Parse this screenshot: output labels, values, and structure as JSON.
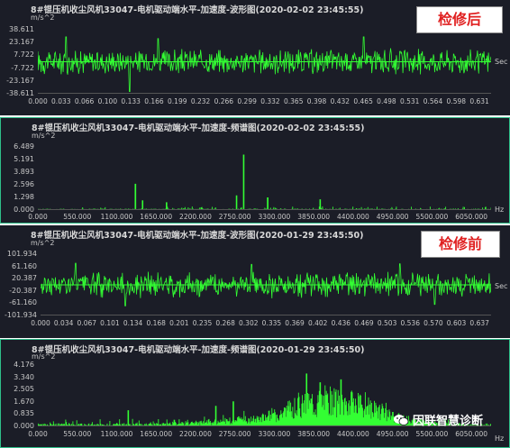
{
  "panels": [
    {
      "title": "8#锟压机收尘风机33047-电机驱动端水平-加速度-波形图(2020-02-02 23:45:55)",
      "unit": "m/s^2",
      "xunit": "Sec",
      "badge": "检修后",
      "yticks": [
        "38.611",
        "23.167",
        "7.722",
        "-7.722",
        "-23.167",
        "-38.611"
      ],
      "xticks": [
        "0.000",
        "0.033",
        "0.066",
        "0.100",
        "0.133",
        "0.166",
        "0.199",
        "0.232",
        "0.266",
        "0.299",
        "0.332",
        "0.365",
        "0.398",
        "0.432",
        "0.465",
        "0.498",
        "0.531",
        "0.564",
        "0.598",
        "0.631"
      ]
    },
    {
      "title": "8#锟压机收尘风机33047-电机驱动端水平-加速度-频谱图(2020-02-02 23:45:55)",
      "unit": "m/s^2",
      "xunit": "Hz",
      "yticks": [
        "6.489",
        "5.191",
        "3.893",
        "2.596",
        "1.298",
        "0.000"
      ],
      "xticks": [
        "0.000",
        "550.000",
        "1100.000",
        "1650.000",
        "2200.000",
        "2750.000",
        "3300.000",
        "3850.000",
        "4400.000",
        "4950.000",
        "5500.000",
        "6050.000"
      ]
    },
    {
      "title": "8#锟压机收尘风机33047-电机驱动端水平-加速度-波形图(2020-01-29 23:45:50)",
      "unit": "m/s^2",
      "xunit": "Sec",
      "badge": "检修前",
      "yticks": [
        "101.934",
        "61.160",
        "20.387",
        "-20.387",
        "-61.160",
        "-101.934"
      ],
      "xticks": [
        "0.000",
        "0.034",
        "0.067",
        "0.101",
        "0.134",
        "0.168",
        "0.201",
        "0.235",
        "0.268",
        "0.302",
        "0.335",
        "0.369",
        "0.402",
        "0.436",
        "0.469",
        "0.503",
        "0.536",
        "0.570",
        "0.603",
        "0.637"
      ]
    },
    {
      "title": "8#锟压机收尘风机33047-电机驱动端水平-加速度-频谱图(2020-01-29 23:45:50)",
      "unit": "m/s^2",
      "xunit": "Hz",
      "yticks": [
        "4.176",
        "3.340",
        "2.505",
        "1.670",
        "0.835",
        "0.000"
      ],
      "xticks": [
        "0.000",
        "550.000",
        "1100.000",
        "1650.000",
        "2200.000",
        "2750.000",
        "3300.000",
        "3850.000",
        "4400.000",
        "4950.000",
        "5500.000",
        "6050.000"
      ]
    }
  ],
  "logo": {
    "text": "因联智慧诊断",
    "icon": "wechat-icon"
  },
  "colors": {
    "signal": "#33ff33",
    "background": "#1b1d27",
    "badge_text": "#e02020"
  },
  "chart_data": [
    {
      "type": "line",
      "title": "8#锟压机收尘风机33047-电机驱动端水平-加速度-波形图(2020-02-02 23:45:55)",
      "xlabel": "Sec",
      "ylabel": "m/s^2",
      "xlim": [
        0,
        0.64
      ],
      "ylim": [
        -38.611,
        38.611
      ],
      "series": [
        {
          "kind": "noise",
          "amplitude": 14,
          "spikes": [
            [
              0.04,
              30
            ],
            [
              0.13,
              -36
            ],
            [
              0.17,
              28
            ],
            [
              0.46,
              30
            ]
          ],
          "samples": 700
        }
      ]
    },
    {
      "type": "line",
      "title": "8#锟压机收尘风机33047-电机驱动端水平-加速度-频谱图(2020-02-02 23:45:55)",
      "xlabel": "Hz",
      "ylabel": "m/s^2",
      "xlim": [
        0,
        6500
      ],
      "ylim": [
        0,
        6.489
      ],
      "series": [
        {
          "kind": "spectrum",
          "floor": 0.15,
          "peaks": [
            [
              1400,
              2.7
            ],
            [
              1500,
              1.0
            ],
            [
              2850,
              1.5
            ],
            [
              2950,
              5.7
            ],
            [
              3300,
              1.3
            ],
            [
              4050,
              1.1
            ],
            [
              1850,
              0.8
            ]
          ],
          "samples": 700
        }
      ]
    },
    {
      "type": "line",
      "title": "8#锟压机收尘风机33047-电机驱动端水平-加速度-波形图(2020-01-29 23:45:50)",
      "xlabel": "Sec",
      "ylabel": "m/s^2",
      "xlim": [
        0,
        0.64
      ],
      "ylim": [
        -101.934,
        101.934
      ],
      "series": [
        {
          "kind": "noise",
          "amplitude": 38,
          "spikes": [
            [
              0.05,
              72
            ],
            [
              0.12,
              -70
            ],
            [
              0.3,
              68
            ],
            [
              0.51,
              70
            ],
            [
              0.56,
              -65
            ]
          ],
          "samples": 700
        }
      ]
    },
    {
      "type": "line",
      "title": "8#锟压机收尘风机33047-电机驱动端水平-加速度-频谱图(2020-01-29 23:45:50)",
      "xlabel": "Hz",
      "ylabel": "m/s^2",
      "xlim": [
        0,
        6500
      ],
      "ylim": [
        0,
        4.176
      ],
      "series": [
        {
          "kind": "spectrum_hump",
          "floor": 0.2,
          "hump_center": 4200,
          "hump_width": 900,
          "hump_height": 1.9,
          "peaks": [
            [
              3850,
              3.6
            ],
            [
              4050,
              3.0
            ],
            [
              4350,
              3.2
            ],
            [
              1300,
              1.1
            ],
            [
              2550,
              1.4
            ],
            [
              2800,
              1.7
            ]
          ],
          "samples": 700
        }
      ]
    }
  ]
}
